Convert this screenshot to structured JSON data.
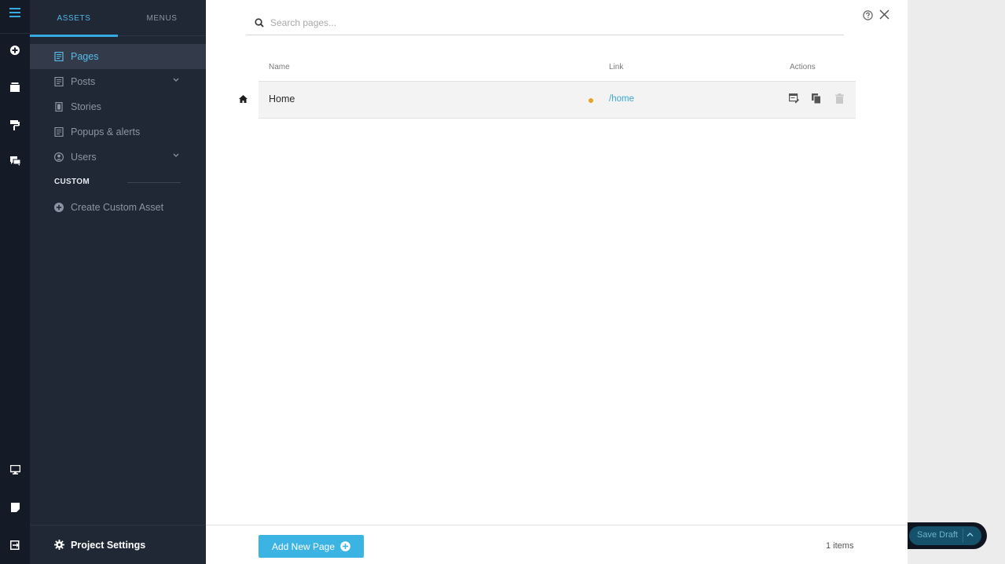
{
  "sidebar": {
    "tabs": [
      {
        "label": "ASSETS",
        "active": true
      },
      {
        "label": "MENUS",
        "active": false
      }
    ],
    "items": [
      {
        "label": "Pages",
        "icon": "page-icon",
        "active": true
      },
      {
        "label": "Posts",
        "icon": "page-icon",
        "expandable": true
      },
      {
        "label": "Stories",
        "icon": "story-icon"
      },
      {
        "label": "Popups & alerts",
        "icon": "page-icon"
      },
      {
        "label": "Users",
        "icon": "user-icon",
        "expandable": true
      }
    ],
    "section_label": "CUSTOM",
    "custom_item": {
      "label": "Create Custom Asset",
      "icon": "plus-circle-icon"
    },
    "footer_label": "Project Settings"
  },
  "search": {
    "placeholder": "Search pages..."
  },
  "table": {
    "headers": {
      "name": "Name",
      "link": "Link",
      "actions": "Actions"
    },
    "rows": [
      {
        "name": "Home",
        "link": "/home",
        "is_home": true,
        "status_color": "#e5a423"
      }
    ]
  },
  "footer": {
    "add_button_label": "Add New Page",
    "item_count": "1 items"
  },
  "save": {
    "label": "Save Draft"
  },
  "colors": {
    "accent": "#36a9e1",
    "rail_bg": "#141a26",
    "sidebar_bg": "#202735",
    "status_draft": "#e5a423"
  }
}
